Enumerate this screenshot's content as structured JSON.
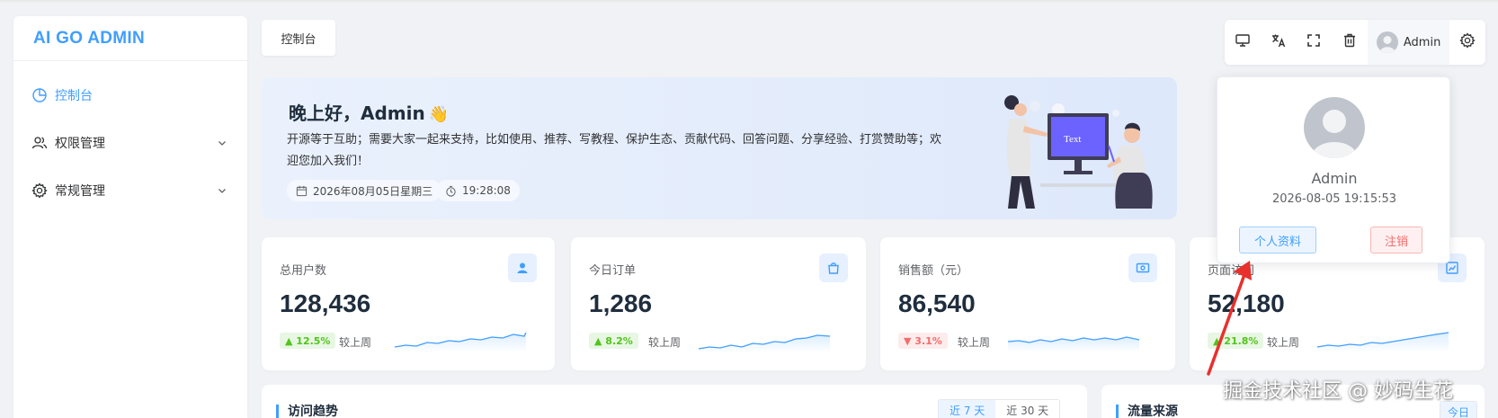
{
  "app": {
    "logo": "AI GO ADMIN"
  },
  "sidebar": {
    "items": [
      {
        "label": "控制台",
        "icon": "pie-chart-icon",
        "active": true
      },
      {
        "label": "权限管理",
        "icon": "users-icon"
      },
      {
        "label": "常规管理",
        "icon": "gear-icon"
      }
    ]
  },
  "tabs": [
    {
      "label": "控制台"
    }
  ],
  "header": {
    "icons": [
      "monitor-icon",
      "translate-icon",
      "fullscreen-icon",
      "trash-icon"
    ],
    "user": "Admin",
    "settings_icon": "gear-icon"
  },
  "banner": {
    "greeting": "晚上好，Admin",
    "wave": "👋",
    "description": "开源等于互助；需要大家一起来支持，比如使用、推荐、写教程、保护生态、贡献代码、回答问题、分享经验、打赏赞助等；欢迎您加入我们！",
    "date": "2026年08月05日星期三",
    "time": "19:28:08",
    "illustration_text": "Text"
  },
  "stats": [
    {
      "title": "总用户数",
      "value": "128,436",
      "change": "12.5%",
      "trend": "up",
      "compare": "较上周",
      "icon": "user-icon",
      "color": "#409eff"
    },
    {
      "title": "今日订单",
      "value": "1,286",
      "change": "8.2%",
      "trend": "up",
      "compare": "较上周",
      "icon": "shopping-bag-icon",
      "color": "#409eff"
    },
    {
      "title": "销售额（元）",
      "value": "86,540",
      "change": "3.1%",
      "trend": "down",
      "compare": "较上周",
      "icon": "money-icon",
      "color": "#409eff"
    },
    {
      "title": "页面访问",
      "value": "52,180",
      "change": "21.8%",
      "trend": "up",
      "compare": "较上周",
      "icon": "line-chart-icon",
      "color": "#409eff"
    }
  ],
  "panels": {
    "trend": {
      "title": "访问趋势",
      "range_7": "近 7 天",
      "range_30": "近 30 天"
    },
    "source": {
      "title": "流量来源",
      "range_today": "今日"
    }
  },
  "popover": {
    "name": "Admin",
    "login_time": "2026-08-05 19:15:53",
    "profile_button": "个人资料",
    "logout_button": "注销"
  },
  "watermark": "掘金技术社区 @ 妙码生花",
  "colors": {
    "primary": "#409eff",
    "success": "#52c41a",
    "danger": "#f56c6c"
  }
}
